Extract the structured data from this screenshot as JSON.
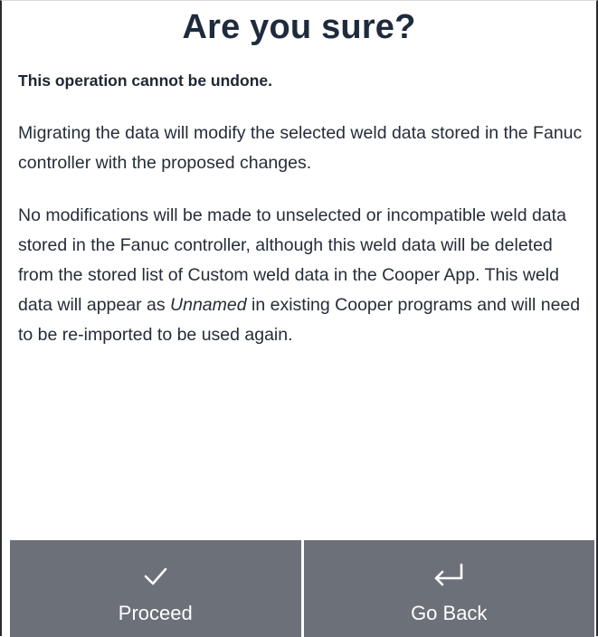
{
  "dialog": {
    "title": "Are you sure?",
    "warning": "This operation cannot be undone.",
    "paragraph1": "Migrating the data will modify the selected weld data stored in the Fanuc controller with the proposed changes.",
    "paragraph2_before": "No modifications will be made to unselected or incompatible weld data stored in the Fanuc controller, although this weld data will be deleted from the stored list of Custom weld data in the Cooper App. This weld data will appear as ",
    "paragraph2_emphasis": "Unnamed",
    "paragraph2_after": " in existing Cooper programs and will need to be re-imported to be used again."
  },
  "footer": {
    "proceed": {
      "label": "Proceed",
      "icon": "checkmark-icon"
    },
    "go_back": {
      "label": "Go Back",
      "icon": "return-arrow-icon"
    }
  },
  "colors": {
    "footer_background": "#6b7079",
    "footer_text": "#ffffff",
    "title_text": "#1e2b3d",
    "body_text": "#262d38",
    "background": "#ffffff"
  }
}
